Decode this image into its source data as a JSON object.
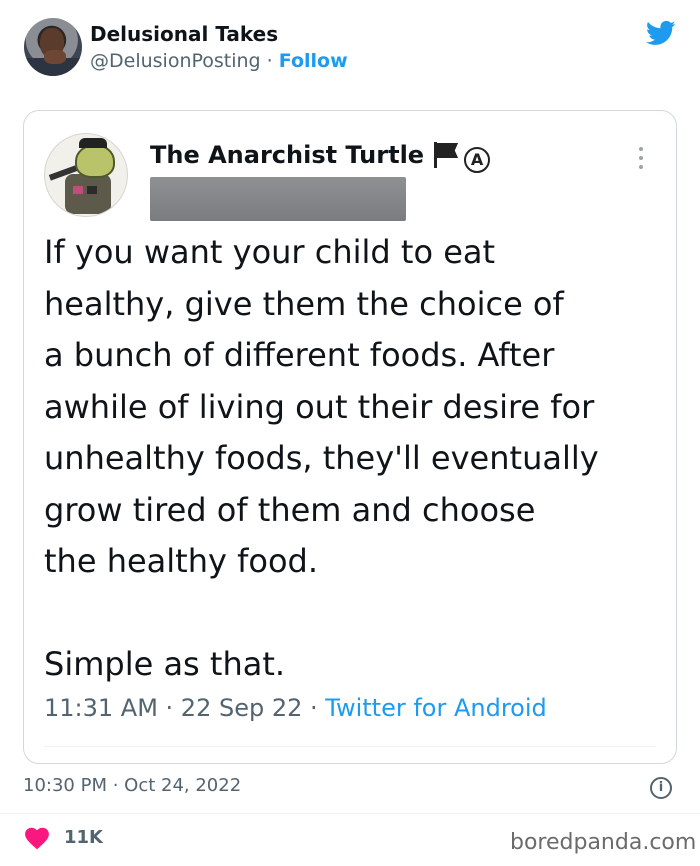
{
  "outer_tweet": {
    "display_name": "Delusional Takes",
    "handle": "@DelusionPosting",
    "separator": " · ",
    "follow_label": "Follow",
    "timestamp": "10:30 PM · Oct 24, 2022",
    "likes": "11K"
  },
  "quoted_tweet": {
    "display_name": "The Anarchist Turtle",
    "text": "If you want your child to eat\nhealthy, give them the choice of\na bunch of different foods. After\nawhile of living out their desire for\nunhealthy foods, they'll eventually\ngrow tired of them and choose\nthe healthy food.\n\nSimple as that.",
    "time_date": "11:31 AM · 22 Sep 22 · ",
    "source": "Twitter for Android"
  },
  "icons": {
    "bird": "twitter-bird-icon",
    "flag": "black-flag-icon",
    "anarchy": "anarchy-symbol-icon",
    "more": "more-vertical-icon",
    "info": "info-icon",
    "heart": "heart-icon"
  },
  "colors": {
    "accent": "#1d9bf0",
    "heart": "#f91880",
    "muted": "#536471",
    "text": "#0f1419"
  },
  "watermark": "boredpanda.com"
}
